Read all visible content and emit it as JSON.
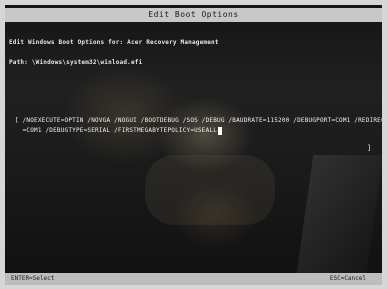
{
  "screen": {
    "title": "Edit Boot Options",
    "heading": "Edit Windows Boot Options for: Acer Recovery Management",
    "path_label": "Path:",
    "path_value": "\\Windows\\system32\\winload.efi",
    "options_line1": "[ /NOEXECUTE=OPTIN /NOVGA /NOGUI /BOOTDEBUG /SOS /DEBUG /BAUDRATE=115200 /DEBUGPORT=COM1 /REDIRECT",
    "options_line2": "  =COM1 /DEBUGTYPE=SERIAL /FIRSTMEGABYTEPOLICY=USEALL",
    "close_bracket": "]",
    "footer_left": "ENTER=Select",
    "footer_right": "ESC=Cancel"
  }
}
